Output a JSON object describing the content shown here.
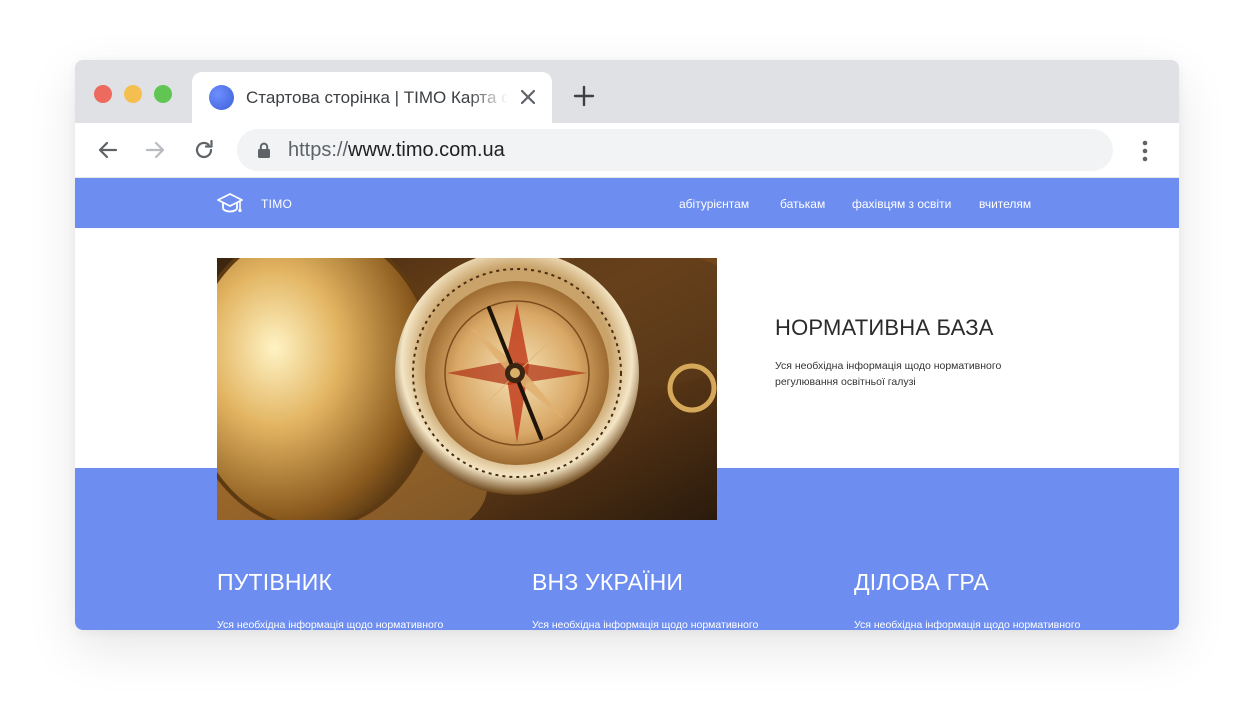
{
  "browser": {
    "tab": {
      "title": "Стартова сторінка | TIMO Карта освітніх послуг",
      "favicon": "globe-favicon"
    },
    "address_bar": {
      "scheme": "https://",
      "host": "www.timo.com.ua"
    },
    "icons": {
      "back": "back-arrow-icon",
      "forward": "forward-arrow-icon",
      "reload": "reload-icon",
      "lock": "lock-icon",
      "new_tab": "plus-icon",
      "close_tab": "close-icon",
      "menu": "kebab-menu-icon"
    }
  },
  "site": {
    "brand": {
      "logo_icon": "graduation-cap-icon",
      "name": "TIMO"
    },
    "nav": [
      {
        "label": "абітурієнтам"
      },
      {
        "label": "батькам"
      },
      {
        "label": "фахівцям з освіти"
      },
      {
        "label": "вчителям"
      }
    ],
    "hero": {
      "image": "compass-photo",
      "title": "НОРМАТИВНА БАЗА",
      "description": "Уся необхідна інформація щодо нормативного регулювання освітньої галузі"
    },
    "cards": [
      {
        "title": "ПУТІВНИК",
        "description": "Уся необхідна інформація щодо нормативного"
      },
      {
        "title": "ВНЗ УКРАЇНИ",
        "description": "Уся необхідна інформація щодо нормативного"
      },
      {
        "title": "ДІЛОВА ГРА",
        "description": "Уся необхідна інформація щодо нормативного"
      }
    ],
    "colors": {
      "accent": "#6d8ef0",
      "text_dark": "#2a2a2a"
    }
  }
}
